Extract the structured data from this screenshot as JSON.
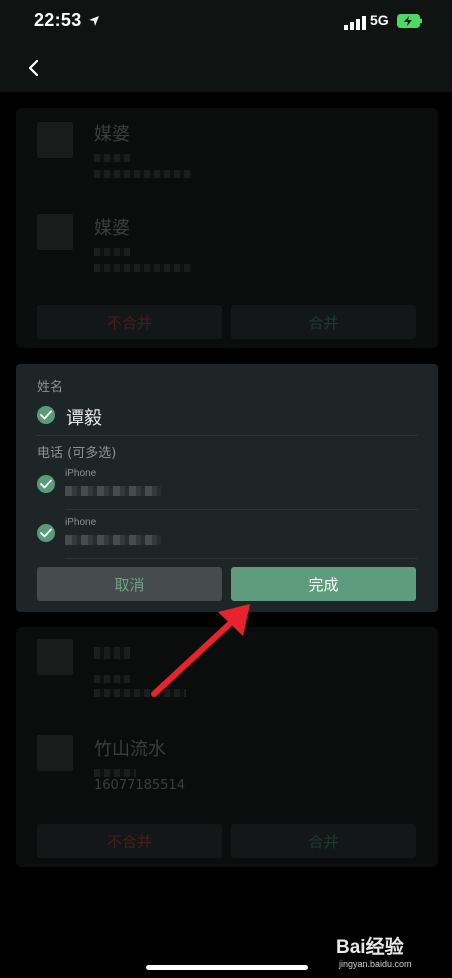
{
  "status": {
    "time": "22:53",
    "network": "5G"
  },
  "top_card": {
    "contacts": [
      {
        "name": "媒婆"
      },
      {
        "name": "媒婆"
      }
    ],
    "no_merge_label": "不合并",
    "merge_label": "合并"
  },
  "dialog": {
    "name_section_label": "姓名",
    "selected_name": "谭毅",
    "phone_section_label": "电话 (可多选)",
    "phones": [
      {
        "label": "iPhone"
      },
      {
        "label": "iPhone"
      }
    ],
    "cancel_label": "取消",
    "done_label": "完成"
  },
  "bottom_card": {
    "contacts": [
      {
        "name": ""
      },
      {
        "name": "竹山流水",
        "number": "16077185514"
      }
    ],
    "no_merge_label": "不合并",
    "merge_label": "合并"
  },
  "watermark": {
    "logo": "Bai经验",
    "sub": "jingyan.baidu.com"
  },
  "colors": {
    "accent_green": "#5e9c7d",
    "dialog_bg": "#1d2526",
    "danger_red": "#4a1d1d"
  }
}
